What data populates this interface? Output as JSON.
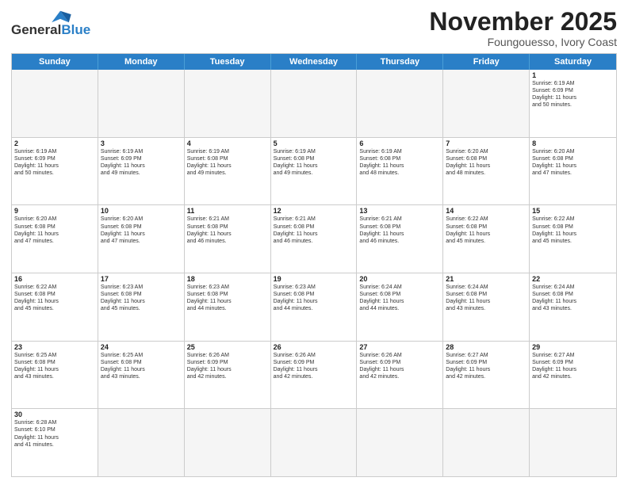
{
  "header": {
    "logo_general": "General",
    "logo_blue": "Blue",
    "month_title": "November 2025",
    "location": "Foungouesso, Ivory Coast"
  },
  "weekdays": [
    "Sunday",
    "Monday",
    "Tuesday",
    "Wednesday",
    "Thursday",
    "Friday",
    "Saturday"
  ],
  "rows": [
    [
      {
        "day": "",
        "info": ""
      },
      {
        "day": "",
        "info": ""
      },
      {
        "day": "",
        "info": ""
      },
      {
        "day": "",
        "info": ""
      },
      {
        "day": "",
        "info": ""
      },
      {
        "day": "",
        "info": ""
      },
      {
        "day": "1",
        "info": "Sunrise: 6:19 AM\nSunset: 6:09 PM\nDaylight: 11 hours\nand 50 minutes."
      }
    ],
    [
      {
        "day": "2",
        "info": "Sunrise: 6:19 AM\nSunset: 6:09 PM\nDaylight: 11 hours\nand 50 minutes."
      },
      {
        "day": "3",
        "info": "Sunrise: 6:19 AM\nSunset: 6:09 PM\nDaylight: 11 hours\nand 49 minutes."
      },
      {
        "day": "4",
        "info": "Sunrise: 6:19 AM\nSunset: 6:08 PM\nDaylight: 11 hours\nand 49 minutes."
      },
      {
        "day": "5",
        "info": "Sunrise: 6:19 AM\nSunset: 6:08 PM\nDaylight: 11 hours\nand 49 minutes."
      },
      {
        "day": "6",
        "info": "Sunrise: 6:19 AM\nSunset: 6:08 PM\nDaylight: 11 hours\nand 48 minutes."
      },
      {
        "day": "7",
        "info": "Sunrise: 6:20 AM\nSunset: 6:08 PM\nDaylight: 11 hours\nand 48 minutes."
      },
      {
        "day": "8",
        "info": "Sunrise: 6:20 AM\nSunset: 6:08 PM\nDaylight: 11 hours\nand 47 minutes."
      }
    ],
    [
      {
        "day": "9",
        "info": "Sunrise: 6:20 AM\nSunset: 6:08 PM\nDaylight: 11 hours\nand 47 minutes."
      },
      {
        "day": "10",
        "info": "Sunrise: 6:20 AM\nSunset: 6:08 PM\nDaylight: 11 hours\nand 47 minutes."
      },
      {
        "day": "11",
        "info": "Sunrise: 6:21 AM\nSunset: 6:08 PM\nDaylight: 11 hours\nand 46 minutes."
      },
      {
        "day": "12",
        "info": "Sunrise: 6:21 AM\nSunset: 6:08 PM\nDaylight: 11 hours\nand 46 minutes."
      },
      {
        "day": "13",
        "info": "Sunrise: 6:21 AM\nSunset: 6:08 PM\nDaylight: 11 hours\nand 46 minutes."
      },
      {
        "day": "14",
        "info": "Sunrise: 6:22 AM\nSunset: 6:08 PM\nDaylight: 11 hours\nand 45 minutes."
      },
      {
        "day": "15",
        "info": "Sunrise: 6:22 AM\nSunset: 6:08 PM\nDaylight: 11 hours\nand 45 minutes."
      }
    ],
    [
      {
        "day": "16",
        "info": "Sunrise: 6:22 AM\nSunset: 6:08 PM\nDaylight: 11 hours\nand 45 minutes."
      },
      {
        "day": "17",
        "info": "Sunrise: 6:23 AM\nSunset: 6:08 PM\nDaylight: 11 hours\nand 45 minutes."
      },
      {
        "day": "18",
        "info": "Sunrise: 6:23 AM\nSunset: 6:08 PM\nDaylight: 11 hours\nand 44 minutes."
      },
      {
        "day": "19",
        "info": "Sunrise: 6:23 AM\nSunset: 6:08 PM\nDaylight: 11 hours\nand 44 minutes."
      },
      {
        "day": "20",
        "info": "Sunrise: 6:24 AM\nSunset: 6:08 PM\nDaylight: 11 hours\nand 44 minutes."
      },
      {
        "day": "21",
        "info": "Sunrise: 6:24 AM\nSunset: 6:08 PM\nDaylight: 11 hours\nand 43 minutes."
      },
      {
        "day": "22",
        "info": "Sunrise: 6:24 AM\nSunset: 6:08 PM\nDaylight: 11 hours\nand 43 minutes."
      }
    ],
    [
      {
        "day": "23",
        "info": "Sunrise: 6:25 AM\nSunset: 6:08 PM\nDaylight: 11 hours\nand 43 minutes."
      },
      {
        "day": "24",
        "info": "Sunrise: 6:25 AM\nSunset: 6:08 PM\nDaylight: 11 hours\nand 43 minutes."
      },
      {
        "day": "25",
        "info": "Sunrise: 6:26 AM\nSunset: 6:09 PM\nDaylight: 11 hours\nand 42 minutes."
      },
      {
        "day": "26",
        "info": "Sunrise: 6:26 AM\nSunset: 6:09 PM\nDaylight: 11 hours\nand 42 minutes."
      },
      {
        "day": "27",
        "info": "Sunrise: 6:26 AM\nSunset: 6:09 PM\nDaylight: 11 hours\nand 42 minutes."
      },
      {
        "day": "28",
        "info": "Sunrise: 6:27 AM\nSunset: 6:09 PM\nDaylight: 11 hours\nand 42 minutes."
      },
      {
        "day": "29",
        "info": "Sunrise: 6:27 AM\nSunset: 6:09 PM\nDaylight: 11 hours\nand 42 minutes."
      }
    ],
    [
      {
        "day": "30",
        "info": "Sunrise: 6:28 AM\nSunset: 6:10 PM\nDaylight: 11 hours\nand 41 minutes."
      },
      {
        "day": "",
        "info": ""
      },
      {
        "day": "",
        "info": ""
      },
      {
        "day": "",
        "info": ""
      },
      {
        "day": "",
        "info": ""
      },
      {
        "day": "",
        "info": ""
      },
      {
        "day": "",
        "info": ""
      }
    ]
  ]
}
